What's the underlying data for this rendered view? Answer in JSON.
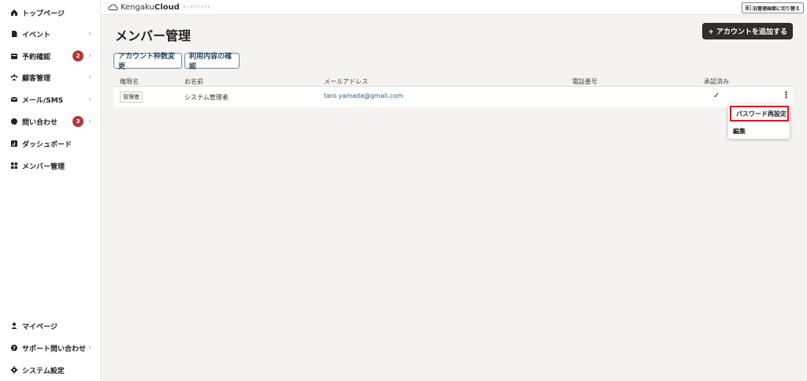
{
  "sidebar": {
    "items": [
      {
        "label": "トップページ",
        "icon": "home-icon"
      },
      {
        "label": "イベント",
        "icon": "document-icon",
        "chevron": "›"
      },
      {
        "label": "予約確認",
        "icon": "calendar-icon",
        "badge": "2",
        "chevron": "›"
      },
      {
        "label": "顧客管理",
        "icon": "customers-icon",
        "chevron": "›"
      },
      {
        "label": "メール/SMS",
        "icon": "mail-icon",
        "chevron": "›"
      },
      {
        "label": "問い合わせ",
        "icon": "chat-icon",
        "badge": "3",
        "chevron": "›"
      },
      {
        "label": "ダッシュボード",
        "icon": "chart-icon"
      },
      {
        "label": "メンバー管理",
        "icon": "grid-icon"
      }
    ],
    "bottom_items": [
      {
        "label": "マイページ",
        "icon": "user-icon"
      },
      {
        "label": "サポート問い合わせ",
        "icon": "help-icon",
        "chevron": "›"
      },
      {
        "label": "システム設定",
        "icon": "gear-icon"
      }
    ]
  },
  "topbar": {
    "brand_light": "Kengaku",
    "brand_bold": "Cloud",
    "brand_kana": "ケンガククラウド",
    "switch_label": "旧管理画面に切り替え"
  },
  "main": {
    "title": "メンバー管理",
    "add_button": "+ アカウントを追加する",
    "tabs": [
      "アカウント枠数変更",
      "利用内容の確認"
    ],
    "columns": [
      "権限名",
      "お名前",
      "メールアドレス",
      "電話番号",
      "承認済み"
    ],
    "rows": [
      {
        "role": "管理者",
        "name": "システム管理者",
        "email": "taro.yamada@gmail.com",
        "phone": "",
        "approved": "✓"
      }
    ],
    "kebab": "⋮"
  },
  "menu": {
    "items": [
      "パスワード再設定",
      "編集"
    ]
  },
  "colors": {
    "badge": "#b23a3a",
    "highlight": "#e0141e",
    "dark_button": "#2e2e2e",
    "link": "#2c5d85"
  }
}
